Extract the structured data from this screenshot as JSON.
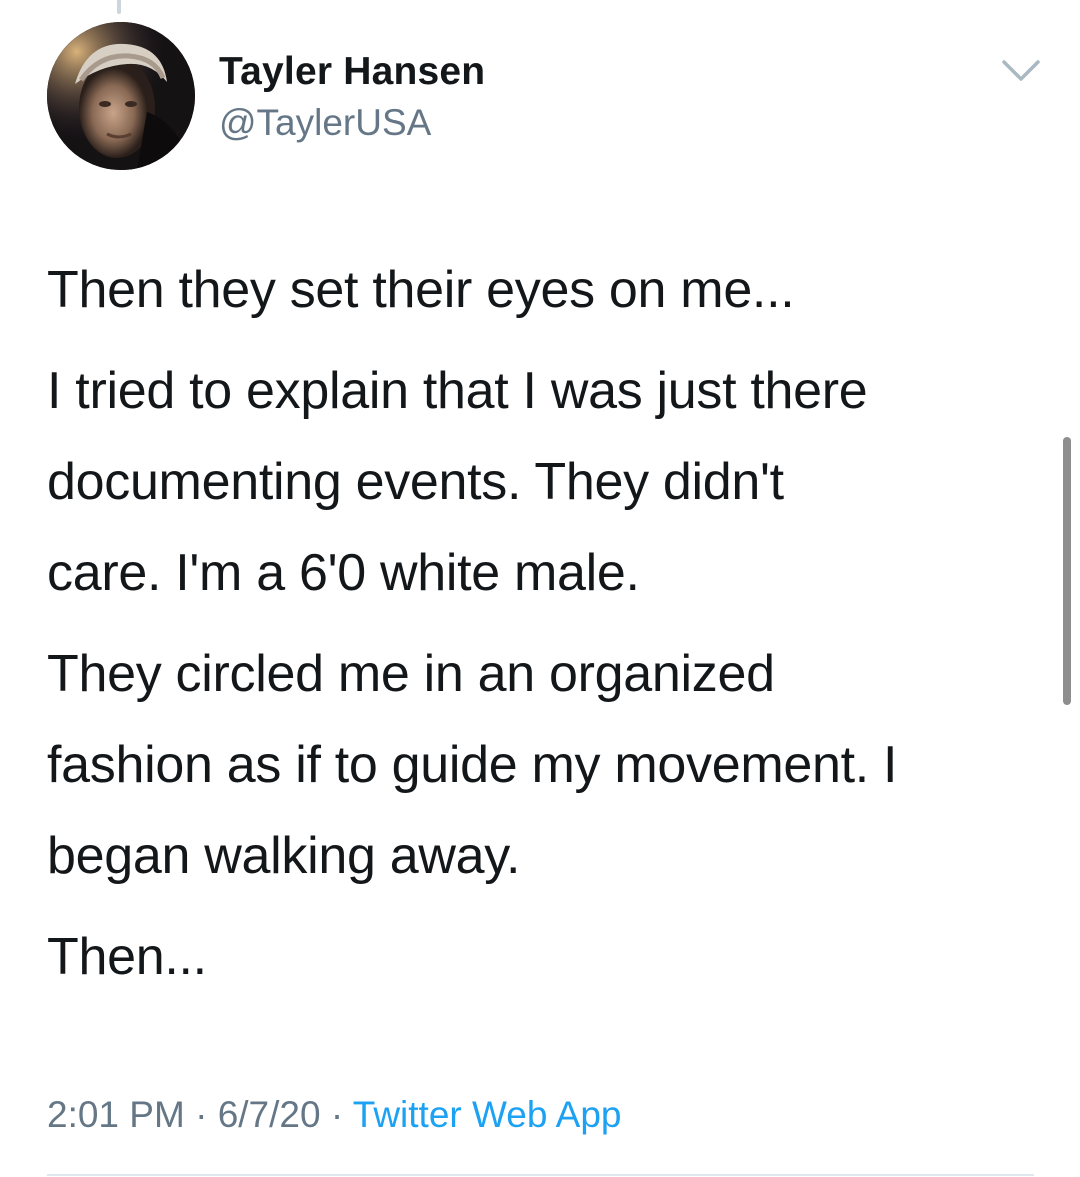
{
  "author": {
    "name": "Tayler Hansen",
    "handle": "@TaylerUSA",
    "avatar_icon": "profile-photo"
  },
  "tweet": {
    "paragraphs": [
      "Then they set their eyes on me...",
      "I tried to explain that I was just there\ndocumenting events. They didn't\ncare. I'm a 6'0 white male.",
      "They circled me in an organized\nfashion as if to guide my movement. I\nbegan walking away.",
      "Then..."
    ]
  },
  "meta": {
    "time": "2:01 PM",
    "separator": " · ",
    "date": "6/7/20",
    "source": "Twitter Web App"
  },
  "colors": {
    "text": "#14171a",
    "secondary": "#657786",
    "link": "#1da1f2",
    "divider": "#e1e8ed"
  },
  "icons": {
    "more_menu": "chevron-down-icon"
  }
}
